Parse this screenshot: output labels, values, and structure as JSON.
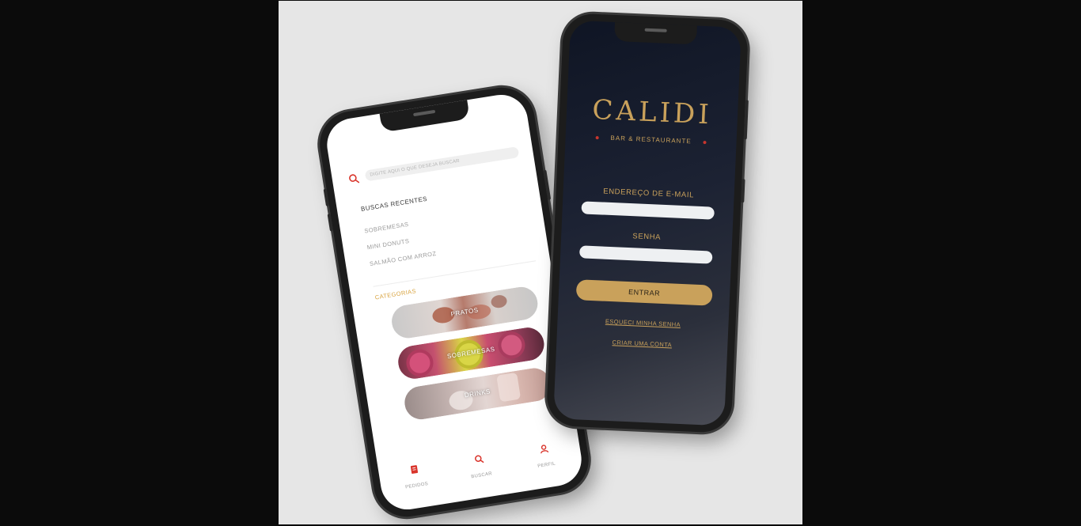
{
  "left_phone": {
    "search": {
      "placeholder": "DIGITE AQUI O QUE DESEJA BUSCAR"
    },
    "recent": {
      "title": "BUSCAS RECENTES",
      "items": [
        "SOBREMESAS",
        "MINI DONUTS",
        "SALMÃO COM ARROZ"
      ]
    },
    "categories": {
      "title": "CATEGORIAS",
      "items": [
        "PRATOS",
        "SOBREMESAS",
        "DRINKS"
      ]
    },
    "tabbar": {
      "items": [
        "PEDIDOS",
        "BUSCAR",
        "PERFIL"
      ]
    }
  },
  "right_phone": {
    "logo": {
      "word": "CALIDI",
      "subtitle": "BAR & RESTAURANTE"
    },
    "email_label": "ENDEREÇO DE E-MAIL",
    "password_label": "SENHA",
    "login_button": "ENTRAR",
    "forgot_link": "ESQUECI MINHA SENHA",
    "signup_link": "CRIAR UMA CONTA"
  },
  "colors": {
    "accent_gold": "#c9a15b",
    "accent_red": "#d9342b",
    "dark_bg": "#1c2233"
  }
}
